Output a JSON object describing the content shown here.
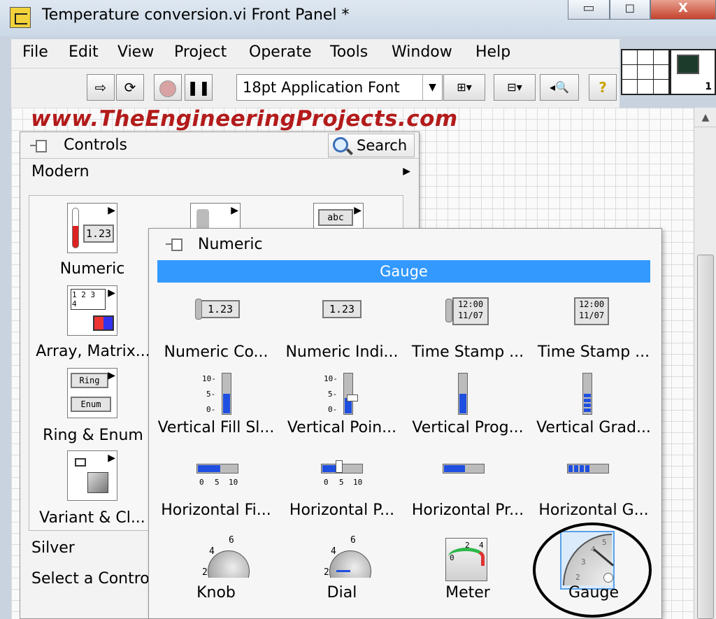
{
  "window": {
    "title": "Temperature conversion.vi Front Panel *",
    "minimize": "▭",
    "maximize": "◻",
    "close": "X"
  },
  "menu": [
    "File",
    "Edit",
    "View",
    "Project",
    "Operate",
    "Tools",
    "Window",
    "Help"
  ],
  "toolbar": {
    "font": "18pt Application Font",
    "connector_index": "1"
  },
  "watermark": "www.TheEngineeringProjects.com",
  "controls_palette": {
    "title": "Controls",
    "search": "Search",
    "section_modern": "Modern",
    "categories": [
      {
        "label": "Numeric",
        "icon_text": "1.23"
      },
      {
        "label": "Array, Matrix..."
      },
      {
        "label": "Ring & Enum",
        "icon_text_1": "Ring",
        "icon_text_2": "Enum"
      },
      {
        "label": "Variant & Cl..."
      }
    ],
    "top_icon_text": "abc",
    "array_icon_text": "1 2 3 4",
    "section_silver": "Silver",
    "section_select": "Select a Contro"
  },
  "numeric_palette": {
    "title": "Numeric",
    "tooltip": "Gauge",
    "items": [
      {
        "label": "Numeric Co...",
        "icon_text": "1.23"
      },
      {
        "label": "Numeric Indi...",
        "icon_text": "1.23"
      },
      {
        "label": "Time Stamp ...",
        "icon_text": "12:00 11/07"
      },
      {
        "label": "Time Stamp ...",
        "icon_text": "12:00 11/07"
      },
      {
        "label": "Vertical Fill Sl...",
        "ticks": [
          "10-",
          "5-",
          "0-"
        ]
      },
      {
        "label": "Vertical Poin...",
        "ticks": [
          "10-",
          "5-",
          "0-"
        ]
      },
      {
        "label": "Vertical Prog..."
      },
      {
        "label": "Vertical Grad..."
      },
      {
        "label": "Horizontal Fi...",
        "ticks": [
          "0",
          "5",
          "10"
        ]
      },
      {
        "label": "Horizontal P...",
        "ticks": [
          "0",
          "5",
          "10"
        ]
      },
      {
        "label": "Horizontal Pr..."
      },
      {
        "label": "Horizontal G..."
      },
      {
        "label": "Knob",
        "ticks": [
          "2",
          "4",
          "6"
        ]
      },
      {
        "label": "Dial",
        "ticks": [
          "2",
          "4",
          "6"
        ]
      },
      {
        "label": "Meter",
        "ticks": [
          "0",
          "2",
          "4"
        ]
      },
      {
        "label": "Gauge",
        "ticks": [
          "2",
          "3",
          "4",
          "5"
        ]
      }
    ]
  },
  "colors": {
    "selection": "#3399ff",
    "fill": "#1f4fe0",
    "watermark": "#b31b1b"
  }
}
